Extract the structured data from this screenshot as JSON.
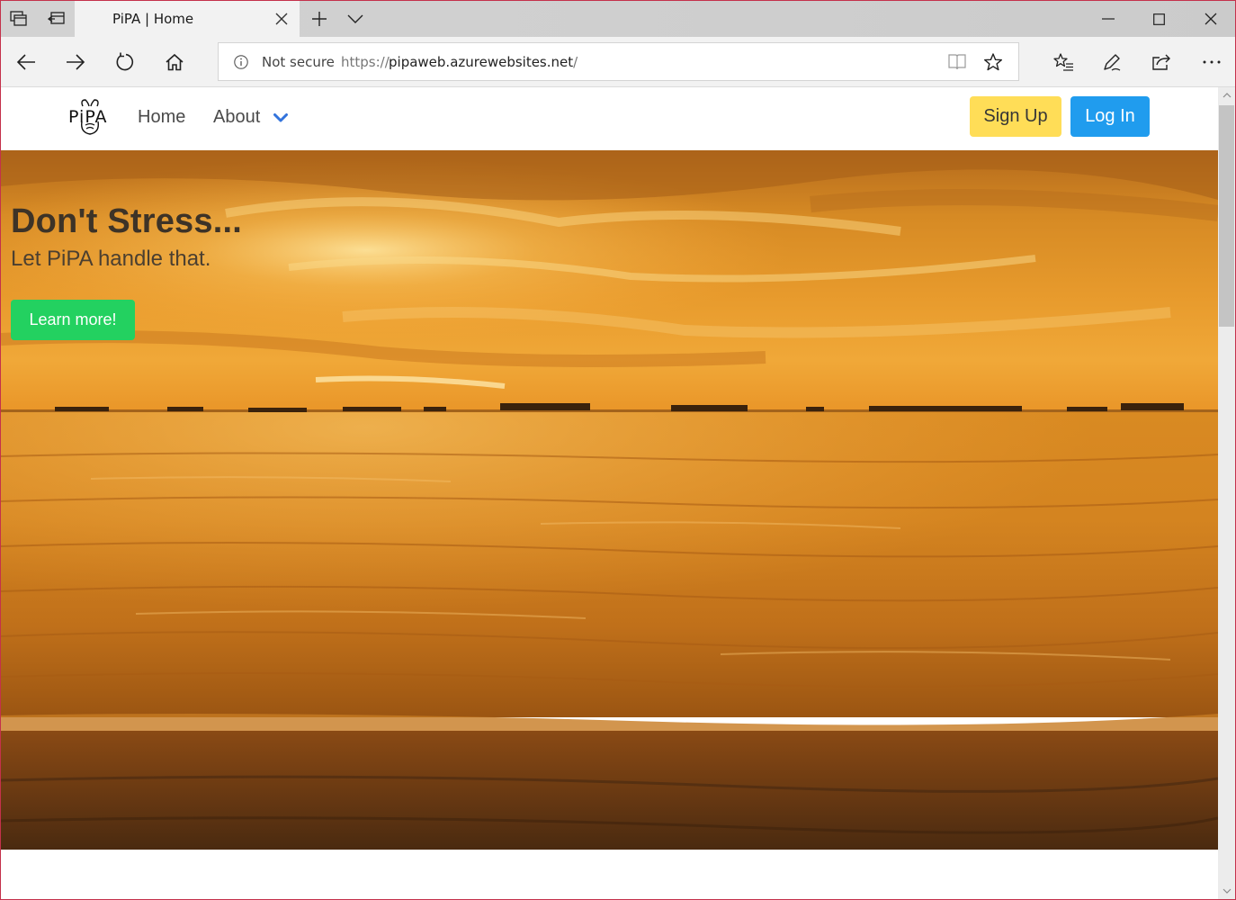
{
  "browser": {
    "tab_title": "PiPA | Home",
    "address": {
      "security_label": "Not secure",
      "scheme": "https://",
      "host": "pipaweb.azurewebsites.net",
      "path": "/"
    },
    "icons": {
      "set_aside_tabs": "set-aside-tabs-icon",
      "tabs_set_aside": "tabs-set-aside-icon",
      "new_tab": "plus-icon",
      "tab_preview": "chevron-down-icon",
      "back": "back-arrow-icon",
      "forward": "forward-arrow-icon",
      "refresh": "refresh-icon",
      "home": "home-icon",
      "info": "info-icon",
      "reading_view": "book-icon",
      "favorite": "star-icon",
      "favorites_hub": "favorites-list-icon",
      "notes": "pen-icon",
      "share": "share-icon",
      "more": "more-icon"
    }
  },
  "site": {
    "logo_text": "PiPA",
    "nav": {
      "home": "Home",
      "about": "About"
    },
    "buttons": {
      "signup": "Sign Up",
      "login": "Log In"
    },
    "hero": {
      "title": "Don't Stress...",
      "subtitle": "Let PiPA handle that.",
      "cta": "Learn more!"
    }
  },
  "colors": {
    "signup_bg": "#ffdd57",
    "login_bg": "#209cee",
    "cta_bg": "#23d160",
    "about_chevron": "#3273dc",
    "frame_border": "#c4314b"
  }
}
